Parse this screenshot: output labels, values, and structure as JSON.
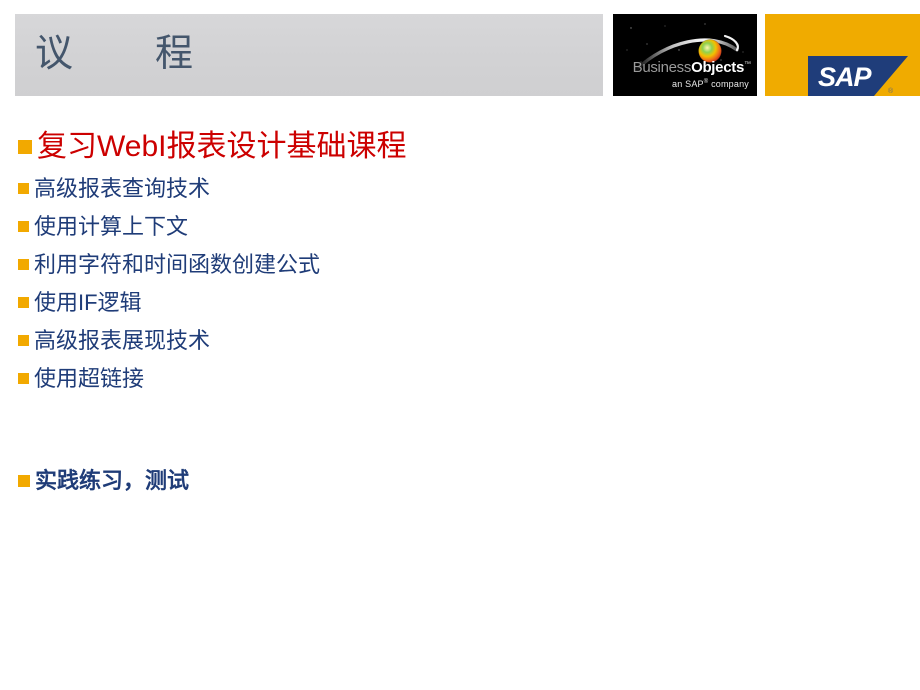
{
  "slide": {
    "title": "议　　程",
    "background_color": "#ffffff"
  },
  "banner": {
    "background_color": "#d4d4d6",
    "title_color": "#44566c"
  },
  "logos": {
    "business_objects": {
      "name": "business-objects-logo",
      "word_business": "Business",
      "word_objects": "Objects",
      "trademark": "™",
      "tagline_prefix": "an SAP",
      "tagline_registered": "®",
      "tagline_suffix": " company",
      "background_color": "#000000",
      "business_color": "#9a9a9a",
      "objects_color": "#ffffff"
    },
    "sap": {
      "name": "sap-logo",
      "text": "SAP",
      "registered": "®",
      "background_color": "#f0ab00",
      "mark_color": "#1f3d7a",
      "text_color": "#ffffff"
    }
  },
  "agenda": {
    "bullet_color": "#f2a900",
    "primary_color": "#cc0000",
    "normal_color": "#1f3c78",
    "items": [
      {
        "label": "复习WebI报表设计基础课程",
        "level": "primary"
      },
      {
        "label": "高级报表查询技术",
        "level": "normal"
      },
      {
        "label": "使用计算上下文",
        "level": "normal"
      },
      {
        "label": "利用字符和时间函数创建公式",
        "level": "normal"
      },
      {
        "label": "使用IF逻辑",
        "level": "normal"
      },
      {
        "label": "高级报表展现技术",
        "level": "normal"
      },
      {
        "label": "使用超链接",
        "level": "normal"
      },
      {
        "label": "实践练习，测试",
        "level": "emphasis"
      }
    ]
  }
}
